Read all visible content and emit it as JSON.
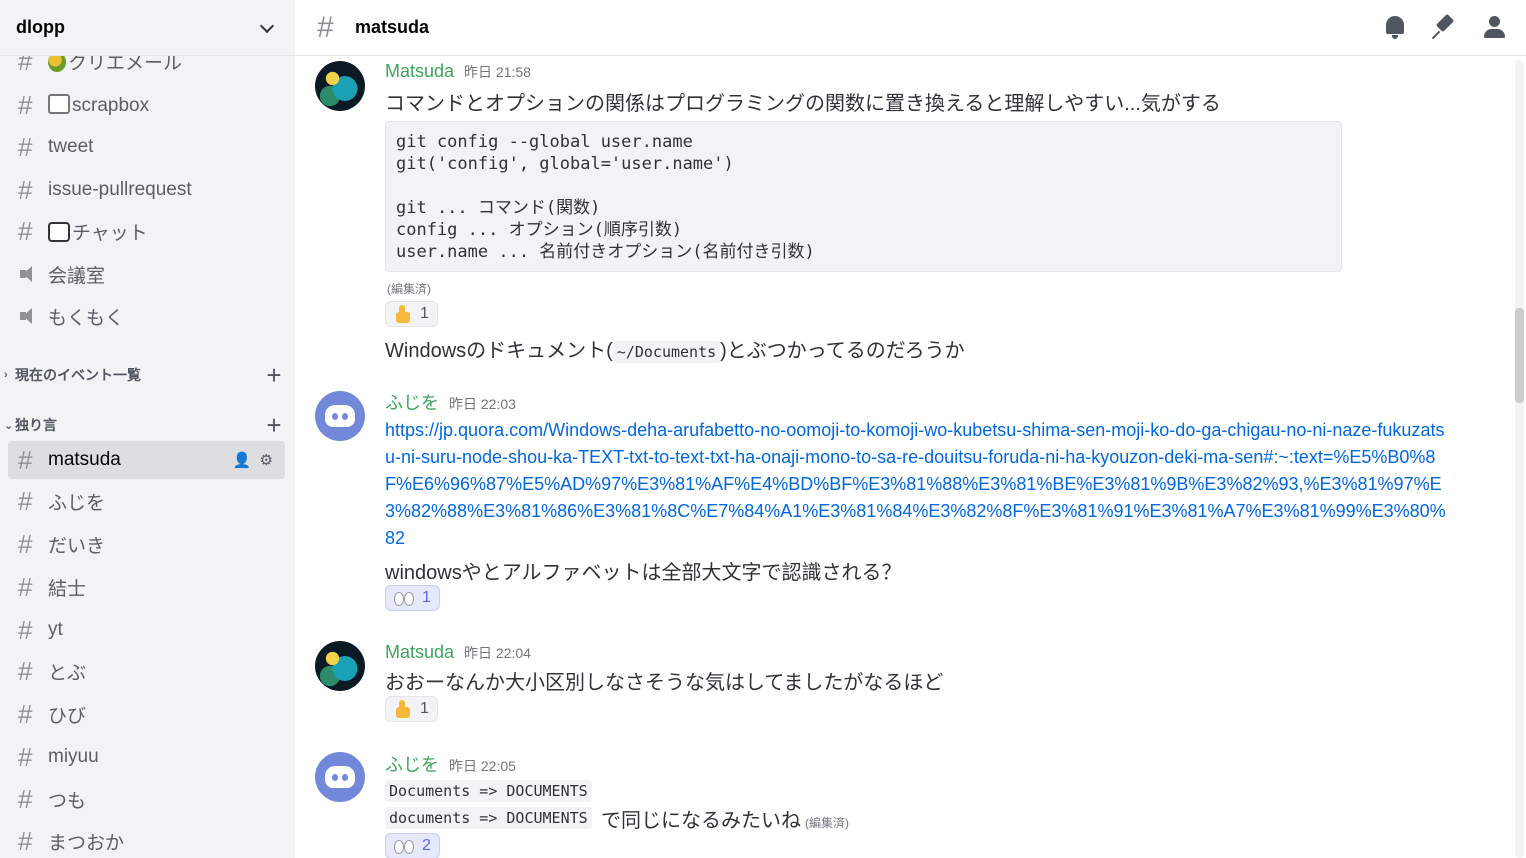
{
  "server": {
    "name": "dlopp"
  },
  "sidebar": {
    "channels_top": [
      {
        "type": "text",
        "emoji": "leaf",
        "label": "クリエメール"
      },
      {
        "type": "text",
        "emoji": "scrap",
        "label": "scrapbox"
      },
      {
        "type": "text",
        "label": "tweet"
      },
      {
        "type": "text",
        "label": "issue-pullrequest"
      },
      {
        "type": "text",
        "emoji": "chat",
        "label": "チャット"
      },
      {
        "type": "voice",
        "label": "会議室"
      },
      {
        "type": "voice",
        "label": "もくもく"
      }
    ],
    "categories": [
      {
        "label": "現在のイベント一覧",
        "collapsed": true
      },
      {
        "label": "独り言",
        "collapsed": false
      }
    ],
    "channels_bottom": [
      {
        "label": "matsuda",
        "active": true
      },
      {
        "label": "ふじを"
      },
      {
        "label": "だいき"
      },
      {
        "label": "結士"
      },
      {
        "label": "yt"
      },
      {
        "label": "とぶ"
      },
      {
        "label": "ひび"
      },
      {
        "label": "miyuu"
      },
      {
        "label": "つも"
      },
      {
        "label": "まつおか"
      }
    ]
  },
  "header": {
    "channel": "matsuda",
    "icons": [
      "bell-icon",
      "pin-icon",
      "members-icon"
    ]
  },
  "messages": [
    {
      "author": "Matsuda",
      "time": "昨日 21:58",
      "text": "コマンドとオプションの関係はプログラミングの関数に置き換えると理解しやすい...気がする",
      "code": "git config --global user.name\ngit('config', global='user.name')\n\ngit ... コマンド(関数)\nconfig ... オプション(順序引数)\nuser.name ... 名前付きオプション(名前付き引数)",
      "edited": "(編集済)",
      "reaction_count": "1",
      "followup_before": "Windowsのドキュメント(",
      "followup_code": "~/Documents",
      "followup_after": ")とぶつかってるのだろうか"
    },
    {
      "author": "ふじを",
      "time": "昨日 22:03",
      "link": "https://jp.quora.com/Windows-deha-arufabetto-no-oomoji-to-komoji-wo-kubetsu-shima-sen-moji-ko-do-ga-chigau-no-ni-naze-fukuzatsu-ni-suru-node-shou-ka-TEXT-txt-to-text-txt-ha-onaji-mono-to-sa-re-douitsu-foruda-ni-ha-kyouzon-deki-ma-sen#:~:text=%E5%B0%8F%E6%96%87%E5%AD%97%E3%81%AF%E4%BD%BF%E3%81%88%E3%81%BE%E3%81%9B%E3%82%93,%E3%81%97%E3%82%88%E3%81%86%E3%81%8C%E7%84%A1%E3%81%84%E3%82%8F%E3%81%91%E3%81%A7%E3%81%99%E3%80%82",
      "text": "windowsやとアルファベットは全部大文字で認識される？",
      "reaction_count": "1"
    },
    {
      "author": "Matsuda",
      "time": "昨日 22:04",
      "text": "おおーなんか大小区別しなさそうな気はしてましたがなるほど",
      "reaction_count": "1"
    },
    {
      "author": "ふじを",
      "time": "昨日 22:05",
      "code_line1": "Documents => DOCUMENTS",
      "code_line2": "documents => DOCUMENTS",
      "text": "で同じになるみたいね",
      "edited": "(編集済)",
      "reaction_count": "2"
    }
  ]
}
